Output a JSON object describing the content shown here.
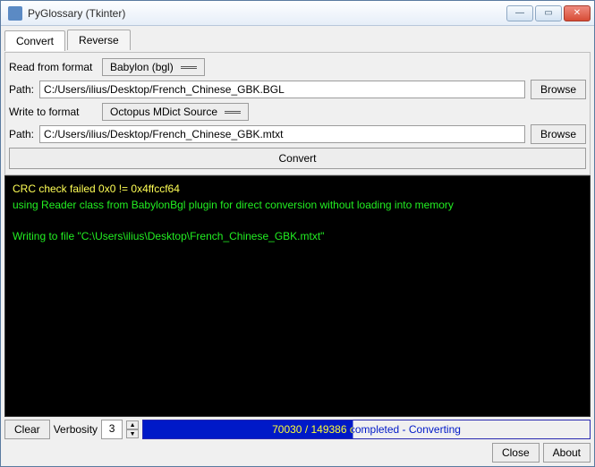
{
  "window": {
    "title": "PyGlossary (Tkinter)"
  },
  "tabs": {
    "convert": "Convert",
    "reverse": "Reverse",
    "active": "convert"
  },
  "form": {
    "read_label": "Read from format",
    "read_format": "Babylon (bgl)",
    "read_path_label": "Path:",
    "read_path": "C:/Users/ilius/Desktop/French_Chinese_GBK.BGL",
    "write_label": "Write to format",
    "write_format": "Octopus MDict Source",
    "write_path_label": "Path:",
    "write_path": "C:/Users/ilius/Desktop/French_Chinese_GBK.mtxt",
    "browse": "Browse",
    "convert_btn": "Convert"
  },
  "terminal": {
    "line1": "CRC check failed 0x0 != 0x4ffccf64",
    "line2": "using Reader class from BabylonBgl plugin for direct conversion without loading into memory",
    "line3": "Writing to file \"C:\\Users\\ilius\\Desktop\\French_Chinese_GBK.mtxt\""
  },
  "status": {
    "clear": "Clear",
    "verbosity_label": "Verbosity",
    "verbosity_value": "3",
    "progress_text": "70030 / 149386 completed - Converting",
    "progress_pct": 47
  },
  "bottom": {
    "close": "Close",
    "about": "About"
  }
}
